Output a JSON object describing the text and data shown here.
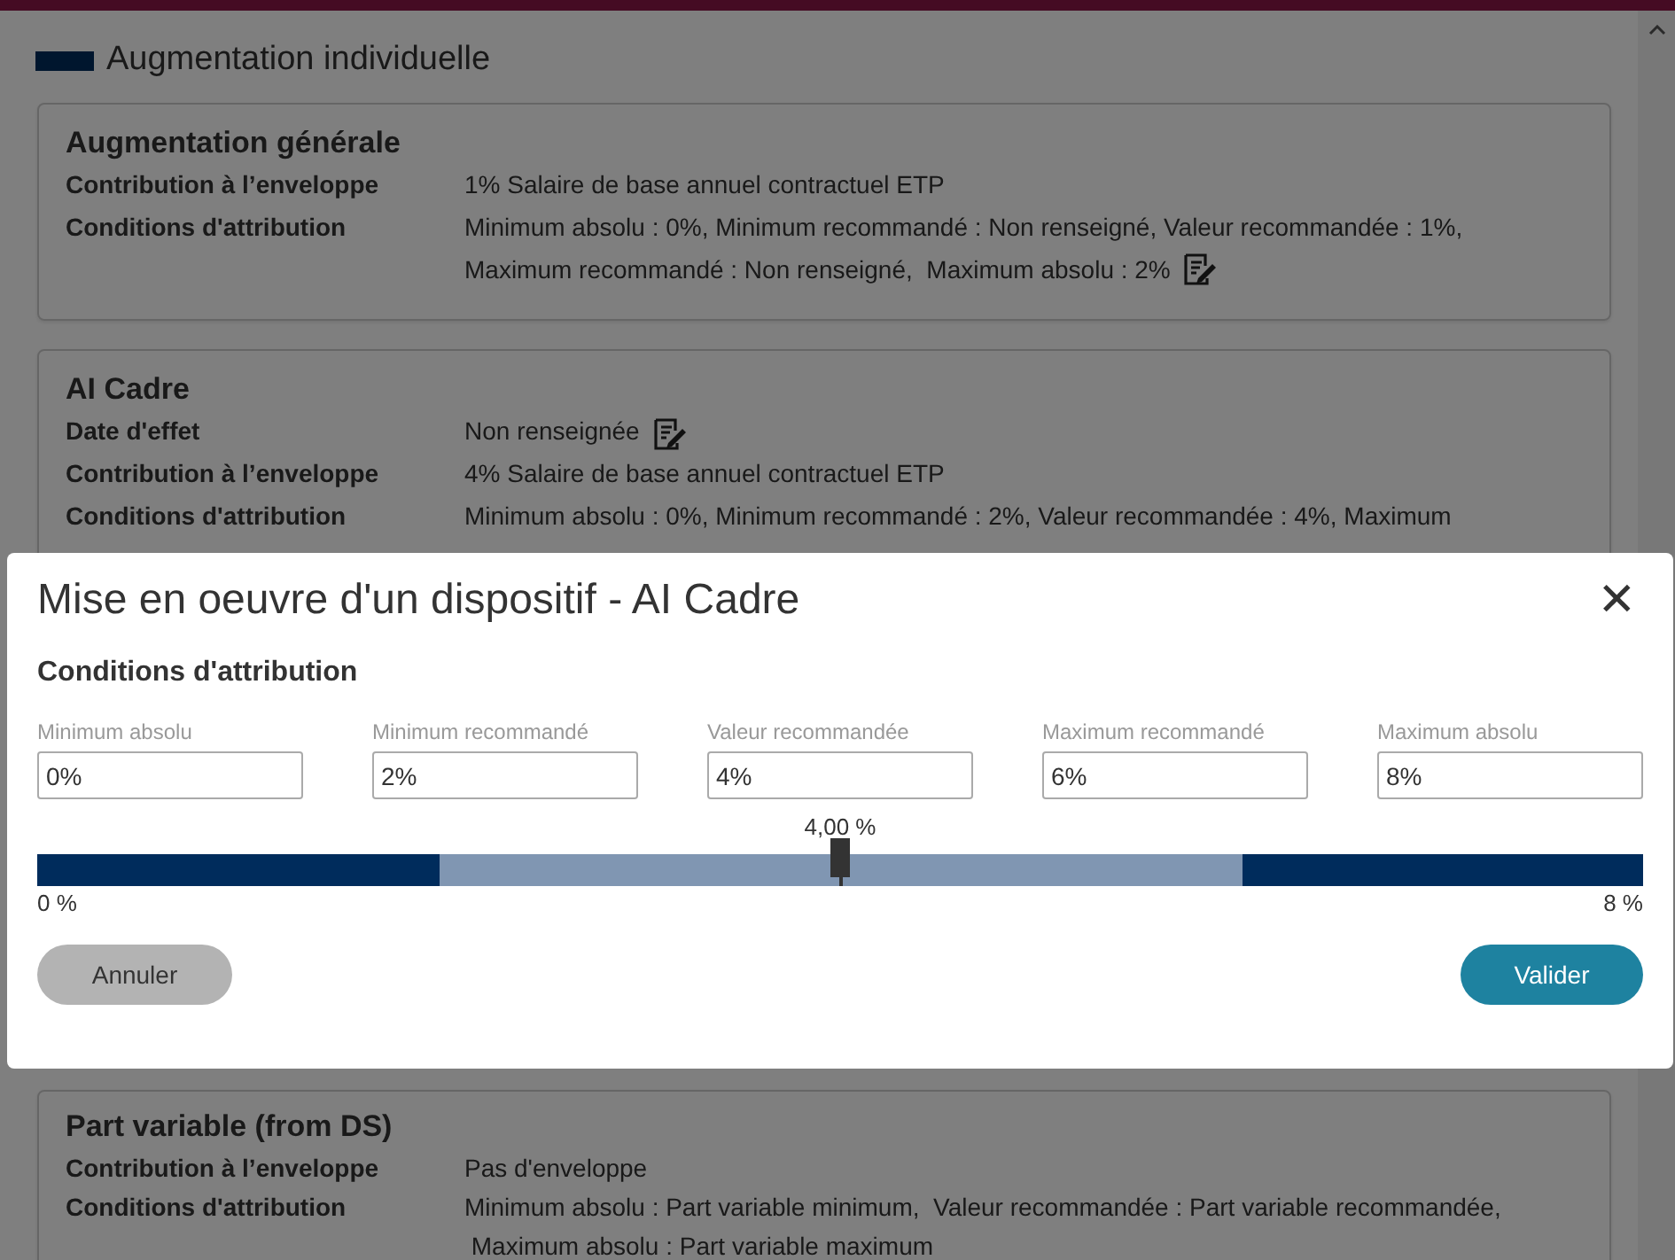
{
  "page": {
    "title": "Augmentation individuelle",
    "cards": [
      {
        "title": "Augmentation générale",
        "rows": [
          {
            "label": "Contribution à l’enveloppe",
            "lines": [
              "1% Salaire de base annuel contractuel ETP"
            ],
            "editable": false
          },
          {
            "label": "Conditions d'attribution",
            "lines": [
              "Minimum absolu : 0%, Minimum recommandé : Non renseigné, Valeur recommandée : 1%,",
              "Maximum recommandé : Non renseigné,  Maximum absolu : 2%"
            ],
            "editable": true
          }
        ]
      },
      {
        "title": "AI Cadre",
        "rows": [
          {
            "label": "Date d'effet",
            "lines": [
              "Non renseignée"
            ],
            "editable": true
          },
          {
            "label": "Contribution à l’enveloppe",
            "lines": [
              "4% Salaire de base annuel contractuel ETP"
            ],
            "editable": false
          },
          {
            "label": "Conditions d'attribution",
            "lines": [
              "Minimum absolu : 0%, Minimum recommandé : 2%, Valeur recommandée : 4%, Maximum"
            ],
            "editable": false
          }
        ]
      },
      {
        "title": "Part variable (from DS)",
        "rows": [
          {
            "label": "Contribution à l’enveloppe",
            "lines": [
              "Pas d'enveloppe"
            ],
            "editable": false
          },
          {
            "label": "Conditions d'attribution",
            "lines": [
              "Minimum absolu : Part variable minimum,  Valeur recommandée : Part variable recommandée,",
              " Maximum absolu : Part variable maximum"
            ],
            "editable": false
          }
        ]
      }
    ]
  },
  "dialog": {
    "title": "Mise en oeuvre d'un dispositif - AI Cadre",
    "close": "✕",
    "section": "Conditions d'attribution",
    "fields": [
      {
        "label": "Minimum absolu",
        "value": "0%"
      },
      {
        "label": "Minimum recommandé",
        "value": "2%"
      },
      {
        "label": "Valeur recommandée",
        "value": "4%"
      },
      {
        "label": "Maximum recommandé",
        "value": "6%"
      },
      {
        "label": "Maximum absolu",
        "value": "8%"
      }
    ],
    "slider": {
      "reading": "4,00 %",
      "min_label": "0 %",
      "max_label": "8 %",
      "level": 0.5,
      "bands": [
        {
          "kind": "recommended",
          "level": 0.75
        },
        {
          "kind": "outside",
          "level": 0.25
        }
      ]
    },
    "buttons": [
      {
        "kind": "secondary",
        "label": "Annuler"
      },
      {
        "kind": "primary",
        "label": "Valider"
      }
    ]
  }
}
